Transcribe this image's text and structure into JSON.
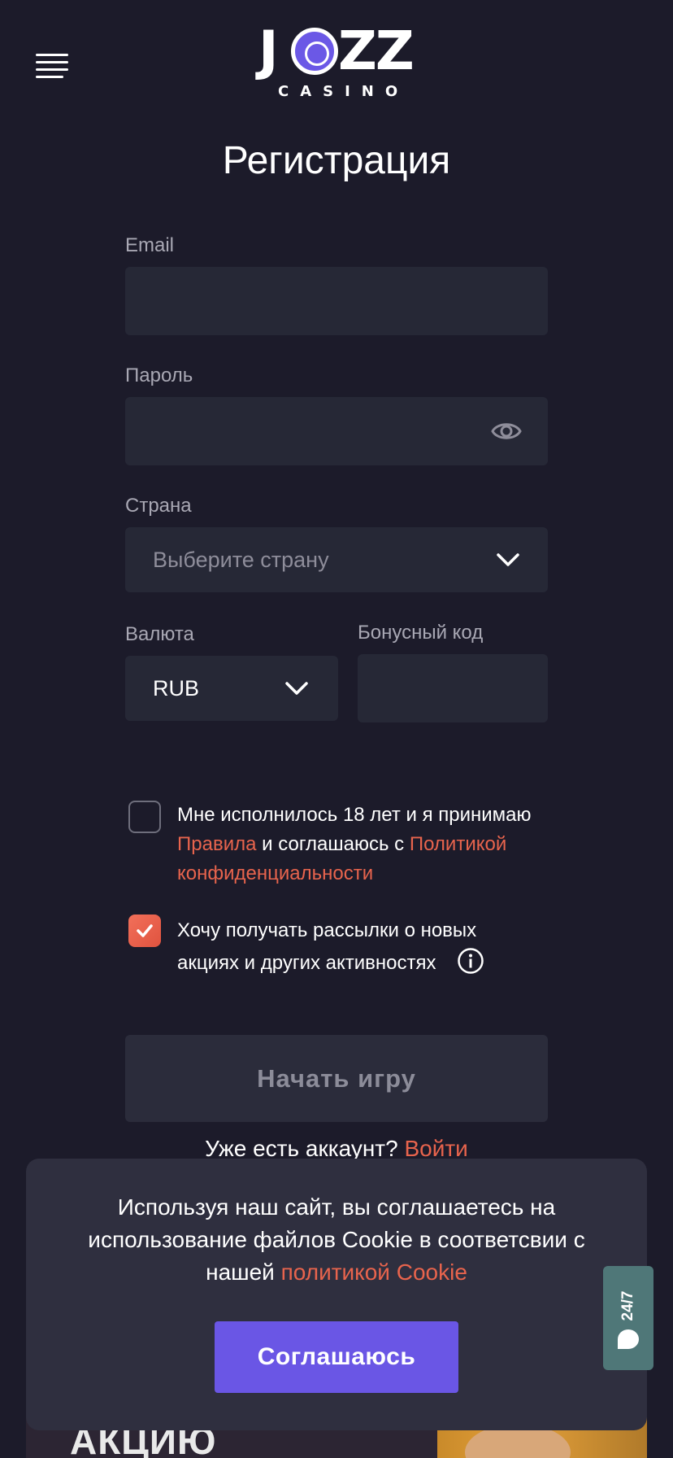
{
  "header": {
    "menu_icon": "hamburger-menu-icon",
    "logo": {
      "word": "JOZZ",
      "subword": "CASINO"
    }
  },
  "page": {
    "title": "Регистрация"
  },
  "form": {
    "email": {
      "label": "Email",
      "value": "",
      "placeholder": ""
    },
    "password": {
      "label": "Пароль",
      "value": "",
      "toggle_icon": "eye-icon"
    },
    "country": {
      "label": "Страна",
      "placeholder": "Выберите страну",
      "icon": "chevron-down-icon"
    },
    "currency": {
      "label": "Валюта",
      "value": "RUB",
      "icon": "chevron-down-icon"
    },
    "bonus": {
      "label": "Бонусный код",
      "value": ""
    },
    "terms": {
      "checked": false,
      "text_1": "Мне исполнилось 18 лет и я принимаю",
      "rules_link": "Правила",
      "text_2": " и соглашаюсь с ",
      "privacy_link_1": "Политикой",
      "privacy_link_2": "конфиденциальности"
    },
    "newsletter": {
      "checked": true,
      "text_1": "Хочу получать рассылки о новых",
      "text_2": "акциях и других активностях",
      "info_icon": "info-icon"
    },
    "submit_label": "Начать игру",
    "login_prompt": "Уже есть аккаунт? ",
    "login_link": "Войти"
  },
  "cookie_banner": {
    "text_1": "Используя наш сайт, вы соглашаетесь на использование файлов Cookie в соответсвии с нашей ",
    "link": "политикой Cookie",
    "button_label": "Соглашаюсь"
  },
  "support": {
    "label": "24/7",
    "icon": "chat-bubble-icon"
  },
  "promo_peek": {
    "text": "АКЦИЮ"
  },
  "colors": {
    "background": "#1c1b2a",
    "field": "#262836",
    "accent": "#e8644d",
    "primary": "#6a56e5",
    "support": "#4f7778"
  }
}
